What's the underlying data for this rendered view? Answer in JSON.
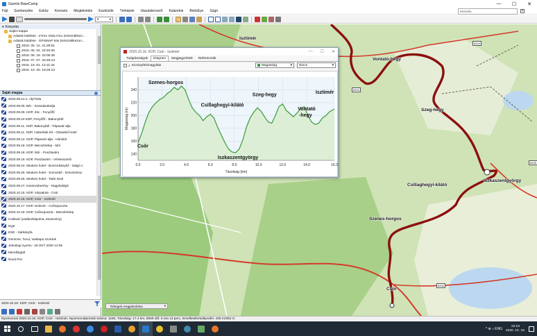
{
  "app": {
    "title": "Garmin BaseCamp",
    "minimize": "—",
    "maximize": "☐",
    "close": "✕"
  },
  "menu": [
    "Fájl",
    "Szerkesztés",
    "Ezköz",
    "Keresés",
    "Megtekintés",
    "Eszközök",
    "Térképek",
    "Utazástervező",
    "Kalandok",
    "BirdsEye",
    "Súgó"
  ],
  "search": {
    "placeholder": "Keresés"
  },
  "toolbar": {
    "zoom_value": "5"
  },
  "library": {
    "header": "Könyvtár",
    "root": "Saját mappa",
    "devices": [
      "Adatok küldése : eTrex Vista HCx (Készülékszi...",
      "Adatok küldése : GPSMAP 64s (Készülékszon..."
    ],
    "entries": [
      "2018. 05. 12. 21:28:51",
      "2018. 06. 02. 22:40:30",
      "2018. 06. 18. 22:00:36",
      "2018. 07. 07. 20:48:13",
      "2018. 10. 01. 12:11:44",
      "2018. 10. 20. 19:26:13"
    ]
  },
  "folder": {
    "title": "Saját mappa",
    "items": [
      "2020.08.21-1. AlpTrida",
      "2020.09.05. Bér - Szandaváralja",
      "2020.09.09. KDP, Zirc - Fenyőfő",
      "2020.09.10 KDP, Fenyőfő - Bakonybél",
      "2020.09.11. KDP, Bakonybél - Pápavár-alja",
      "2020.09.11. KDP, Huberlaki-rét - Odvaskő-hotel",
      "2020.09.12. KDP, Pápavár-alja - Hárskút",
      "2020.09.18. KDP, Mecsértelep - Mór",
      "2020.09.18. KDP, Mór - Pusztavám",
      "2020.09.19. KDP, Pusztavám - Vértessomló",
      "2020.09.24. Medves hotel - Boszorkánykő - Salgó v",
      "2020.09.25. Medves hotel - Somoskő - Ereszt­vényi",
      "2020.09.26. Medves hotel - Tatár-árok",
      "2020.09.27. Karancsberény - Nagyhalápá",
      "2020.10.15. KDP, Várpalota - Csór",
      "2020.10.16. KDP, Csór - Isztimér",
      "2020.10.17. KDP, Isztimér - Csőszpuszta",
      "2020.10.18. KDP, Csőszpuszta - Mecsértelep",
      "Csákvár (vadászkápolna, tanösvény)",
      "Dyje",
      "ESE - Sárkányfa",
      "Gerecse, Turul, Vaskapu szurdok",
      "Jelenlegi nyomv.: 18 OKT 2020 12:05",
      "Mendlingtal",
      "Nová Pec"
    ],
    "selected_index": 15,
    "footer": "2020.10.16. KDP, Csór - Isztimér"
  },
  "dialog": {
    "title": "2020.10.16. KDP, Csór - Isztimér",
    "tabs": [
      "Tulajdonságok",
      "Diagram",
      "Megjegyzések",
      "Referenciák"
    ],
    "active_tab": 1,
    "zoom_checkbox": "Kicsinyítés/nagyítás",
    "select_metric": "Magasság",
    "select_second": "Nincs"
  },
  "chart_data": {
    "type": "area",
    "xlabel": "Távolság (km)",
    "ylabel": "Magasság (m)",
    "xlim": [
      0,
      16.3
    ],
    "ylim": [
      130,
      260
    ],
    "xticks": [
      "0.0",
      "2.0",
      "4.0",
      "6.0",
      "8.0",
      "10.0",
      "12.0",
      "14.0",
      "16.3"
    ],
    "yticks": [
      "140",
      "160",
      "180",
      "200",
      "220",
      "240"
    ],
    "x": [
      0,
      0.3,
      0.6,
      0.9,
      1.2,
      1.5,
      1.8,
      2.1,
      2.4,
      2.7,
      3.0,
      3.3,
      3.6,
      3.9,
      4.2,
      4.5,
      4.8,
      5.1,
      5.4,
      5.7,
      6.0,
      6.3,
      6.6,
      6.9,
      7.2,
      7.5,
      7.8,
      8.1,
      8.4,
      8.7,
      9.0,
      9.3,
      9.6,
      9.9,
      10.2,
      10.5,
      10.8,
      11.1,
      11.4,
      11.7,
      12.0,
      12.3,
      12.6,
      12.9,
      13.2,
      13.5,
      13.8,
      14.1,
      14.4,
      14.7,
      15.0,
      15.3,
      15.6,
      15.9,
      16.3
    ],
    "y": [
      158,
      172,
      190,
      205,
      214,
      220,
      225,
      228,
      234,
      238,
      244,
      240,
      246,
      240,
      225,
      212,
      205,
      200,
      192,
      198,
      202,
      196,
      182,
      170,
      158,
      148,
      143,
      142,
      148,
      162,
      182,
      196,
      205,
      212,
      207,
      198,
      190,
      188,
      200,
      214,
      218,
      208,
      203,
      198,
      204,
      211,
      214,
      200,
      190,
      186,
      188,
      196,
      200,
      206,
      210
    ],
    "annotations": [
      {
        "text": "Szenes-horgos",
        "x": 2.3,
        "y": 249
      },
      {
        "text": "Csór",
        "x": 0.4,
        "y": 150
      },
      {
        "text": "Csillaghegyi-kilátó",
        "x": 7.0,
        "y": 214
      },
      {
        "text": "Iszkaszentgyörgy",
        "x": 8.3,
        "y": 132
      },
      {
        "text": "Szeg-hegy",
        "x": 10.5,
        "y": 230
      },
      {
        "text": "Isztimér",
        "x": 15.5,
        "y": 234
      },
      {
        "text": "Vontató",
        "x": 14.0,
        "y": 208
      },
      {
        "text": "-hegy",
        "x": 13.9,
        "y": 198
      }
    ]
  },
  "map": {
    "labels": [
      "Isztimér",
      "Vontató-hegy",
      "Szeg-hegy",
      "Iszkaszentgyörgy",
      "Csillaghegyi-kilátó",
      "Szenes-horgos",
      "Csór"
    ],
    "road_numbers": [
      "8204",
      "8203",
      "8205",
      "8206"
    ],
    "layer_button": "Rétegek megjelenítése"
  },
  "status_text": "Nyomvonal 2020.10.16. KDP, Csór - Isztimér, Nyomvonalpontok száma: 1150, Távolság: 17.4 km, Eltelt idő: 6 óra 13 perc, Emelkedés/süllyedés: 438 m/363 m",
  "taskbar": {
    "time": "22:23",
    "date": "2020. 10. 19.",
    "tray": "^ ⊕ ♪ ENG"
  }
}
